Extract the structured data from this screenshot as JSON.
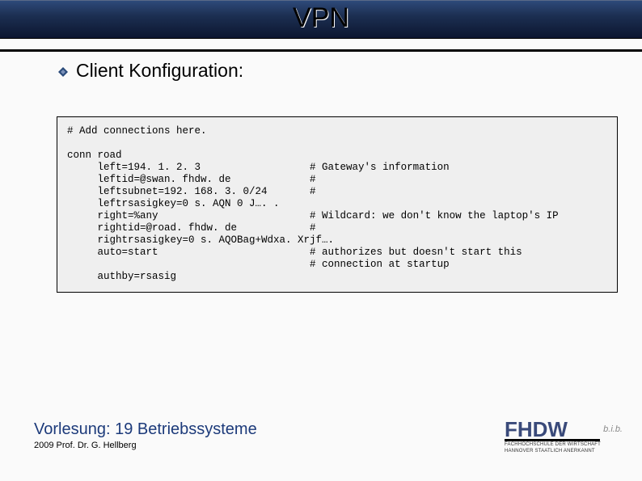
{
  "title": "VPN",
  "subtitle": "Client Konfiguration:",
  "code": "# Add connections here.\n\nconn road\n     left=194. 1. 2. 3                  # Gateway's information\n     leftid=@swan. fhdw. de             #\n     leftsubnet=192. 168. 3. 0/24       #\n     leftrsasigkey=0 s. AQN 0 J…. .\n     right=%any                         # Wildcard: we don't know the laptop's IP\n     rightid=@road. fhdw. de            #\n     rightrsasigkey=0 s. AQOBag+Wdxa. Xrjf….\n     auto=start                         # authorizes but doesn't start this\n                                        # connection at startup\n     authby=rsasig",
  "footer": {
    "title_prefix": "Vorlesung: ",
    "title_number": "19",
    "title_suffix": " Betriebssysteme",
    "sub": "2009 Prof. Dr. G. Hellberg"
  },
  "logo": {
    "name": "FHDW",
    "sub1": "FACHHOCHSCHULE DER WIRTSCHAFT",
    "sub2": "HANNOVER        STAATLICH ANERKANNT",
    "bib": "b.i.b."
  }
}
